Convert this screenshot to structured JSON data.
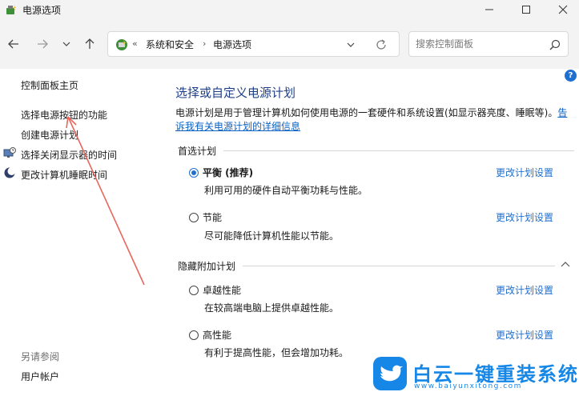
{
  "window": {
    "title": "电源选项"
  },
  "address": {
    "chevrons": "«",
    "crumbs": [
      "系统和安全",
      "电源选项"
    ],
    "separator": "›"
  },
  "search": {
    "placeholder": "搜索控制面板"
  },
  "help": {
    "label": "?"
  },
  "left_panel": {
    "home": "控制面板主页",
    "items": [
      {
        "label": "选择电源按钮的功能",
        "icon": "none"
      },
      {
        "label": "创建电源计划",
        "icon": "none"
      },
      {
        "label": "选择关闭显示器的时间",
        "icon": "monitor-clock-icon"
      },
      {
        "label": "更改计算机睡眠时间",
        "icon": "moon-icon"
      }
    ],
    "see_also": "另请参阅",
    "see_also_items": [
      "用户帐户"
    ]
  },
  "main": {
    "title": "选择或自定义电源计划",
    "description": "电源计划是用于管理计算机如何使用电源的一套硬件和系统设置(如显示器亮度、睡眠等)。",
    "description_link": "告诉我有关电源计划的详细信息",
    "preferred_label": "首选计划",
    "hidden_label": "隐藏附加计划",
    "plans": [
      {
        "name": "平衡 (推荐)",
        "desc": "利用可用的硬件自动平衡功耗与性能。",
        "link": "更改计划设置",
        "selected": true
      },
      {
        "name": "节能",
        "desc": "尽可能降低计算机性能以节能。",
        "link": "更改计划设置",
        "selected": false
      },
      {
        "name": "卓越性能",
        "desc": "在较高端电脑上提供卓越性能。",
        "link": "更改计划设置",
        "selected": false
      },
      {
        "name": "高性能",
        "desc": "有利于提高性能，但会增加功耗。",
        "link": "更改计划设置",
        "selected": false
      }
    ]
  },
  "watermark": {
    "title": "白云一键重装系统",
    "url": "www.baiyunxitong.com"
  },
  "colors": {
    "accent": "#1f6fd1",
    "title_blue": "#1e3f87",
    "annotation": "#e8675f",
    "watermark": "#1687e6"
  }
}
